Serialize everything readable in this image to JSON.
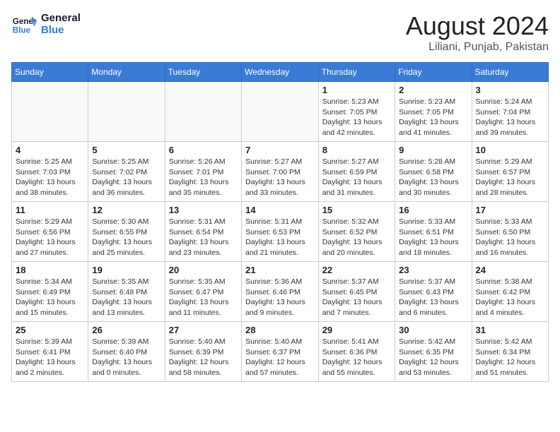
{
  "logo": {
    "line1": "General",
    "line2": "Blue"
  },
  "title": "August 2024",
  "location": "Liliani, Punjab, Pakistan",
  "days_header": [
    "Sunday",
    "Monday",
    "Tuesday",
    "Wednesday",
    "Thursday",
    "Friday",
    "Saturday"
  ],
  "weeks": [
    [
      {
        "day": "",
        "info": ""
      },
      {
        "day": "",
        "info": ""
      },
      {
        "day": "",
        "info": ""
      },
      {
        "day": "",
        "info": ""
      },
      {
        "day": "1",
        "info": "Sunrise: 5:23 AM\nSunset: 7:05 PM\nDaylight: 13 hours\nand 42 minutes."
      },
      {
        "day": "2",
        "info": "Sunrise: 5:23 AM\nSunset: 7:05 PM\nDaylight: 13 hours\nand 41 minutes."
      },
      {
        "day": "3",
        "info": "Sunrise: 5:24 AM\nSunset: 7:04 PM\nDaylight: 13 hours\nand 39 minutes."
      }
    ],
    [
      {
        "day": "4",
        "info": "Sunrise: 5:25 AM\nSunset: 7:03 PM\nDaylight: 13 hours\nand 38 minutes."
      },
      {
        "day": "5",
        "info": "Sunrise: 5:25 AM\nSunset: 7:02 PM\nDaylight: 13 hours\nand 36 minutes."
      },
      {
        "day": "6",
        "info": "Sunrise: 5:26 AM\nSunset: 7:01 PM\nDaylight: 13 hours\nand 35 minutes."
      },
      {
        "day": "7",
        "info": "Sunrise: 5:27 AM\nSunset: 7:00 PM\nDaylight: 13 hours\nand 33 minutes."
      },
      {
        "day": "8",
        "info": "Sunrise: 5:27 AM\nSunset: 6:59 PM\nDaylight: 13 hours\nand 31 minutes."
      },
      {
        "day": "9",
        "info": "Sunrise: 5:28 AM\nSunset: 6:58 PM\nDaylight: 13 hours\nand 30 minutes."
      },
      {
        "day": "10",
        "info": "Sunrise: 5:29 AM\nSunset: 6:57 PM\nDaylight: 13 hours\nand 28 minutes."
      }
    ],
    [
      {
        "day": "11",
        "info": "Sunrise: 5:29 AM\nSunset: 6:56 PM\nDaylight: 13 hours\nand 27 minutes."
      },
      {
        "day": "12",
        "info": "Sunrise: 5:30 AM\nSunset: 6:55 PM\nDaylight: 13 hours\nand 25 minutes."
      },
      {
        "day": "13",
        "info": "Sunrise: 5:31 AM\nSunset: 6:54 PM\nDaylight: 13 hours\nand 23 minutes."
      },
      {
        "day": "14",
        "info": "Sunrise: 5:31 AM\nSunset: 6:53 PM\nDaylight: 13 hours\nand 21 minutes."
      },
      {
        "day": "15",
        "info": "Sunrise: 5:32 AM\nSunset: 6:52 PM\nDaylight: 13 hours\nand 20 minutes."
      },
      {
        "day": "16",
        "info": "Sunrise: 5:33 AM\nSunset: 6:51 PM\nDaylight: 13 hours\nand 18 minutes."
      },
      {
        "day": "17",
        "info": "Sunrise: 5:33 AM\nSunset: 6:50 PM\nDaylight: 13 hours\nand 16 minutes."
      }
    ],
    [
      {
        "day": "18",
        "info": "Sunrise: 5:34 AM\nSunset: 6:49 PM\nDaylight: 13 hours\nand 15 minutes."
      },
      {
        "day": "19",
        "info": "Sunrise: 5:35 AM\nSunset: 6:48 PM\nDaylight: 13 hours\nand 13 minutes."
      },
      {
        "day": "20",
        "info": "Sunrise: 5:35 AM\nSunset: 6:47 PM\nDaylight: 13 hours\nand 11 minutes."
      },
      {
        "day": "21",
        "info": "Sunrise: 5:36 AM\nSunset: 6:46 PM\nDaylight: 13 hours\nand 9 minutes."
      },
      {
        "day": "22",
        "info": "Sunrise: 5:37 AM\nSunset: 6:45 PM\nDaylight: 13 hours\nand 7 minutes."
      },
      {
        "day": "23",
        "info": "Sunrise: 5:37 AM\nSunset: 6:43 PM\nDaylight: 13 hours\nand 6 minutes."
      },
      {
        "day": "24",
        "info": "Sunrise: 5:38 AM\nSunset: 6:42 PM\nDaylight: 13 hours\nand 4 minutes."
      }
    ],
    [
      {
        "day": "25",
        "info": "Sunrise: 5:39 AM\nSunset: 6:41 PM\nDaylight: 13 hours\nand 2 minutes."
      },
      {
        "day": "26",
        "info": "Sunrise: 5:39 AM\nSunset: 6:40 PM\nDaylight: 13 hours\nand 0 minutes."
      },
      {
        "day": "27",
        "info": "Sunrise: 5:40 AM\nSunset: 6:39 PM\nDaylight: 12 hours\nand 58 minutes."
      },
      {
        "day": "28",
        "info": "Sunrise: 5:40 AM\nSunset: 6:37 PM\nDaylight: 12 hours\nand 57 minutes."
      },
      {
        "day": "29",
        "info": "Sunrise: 5:41 AM\nSunset: 6:36 PM\nDaylight: 12 hours\nand 55 minutes."
      },
      {
        "day": "30",
        "info": "Sunrise: 5:42 AM\nSunset: 6:35 PM\nDaylight: 12 hours\nand 53 minutes."
      },
      {
        "day": "31",
        "info": "Sunrise: 5:42 AM\nSunset: 6:34 PM\nDaylight: 12 hours\nand 51 minutes."
      }
    ]
  ]
}
